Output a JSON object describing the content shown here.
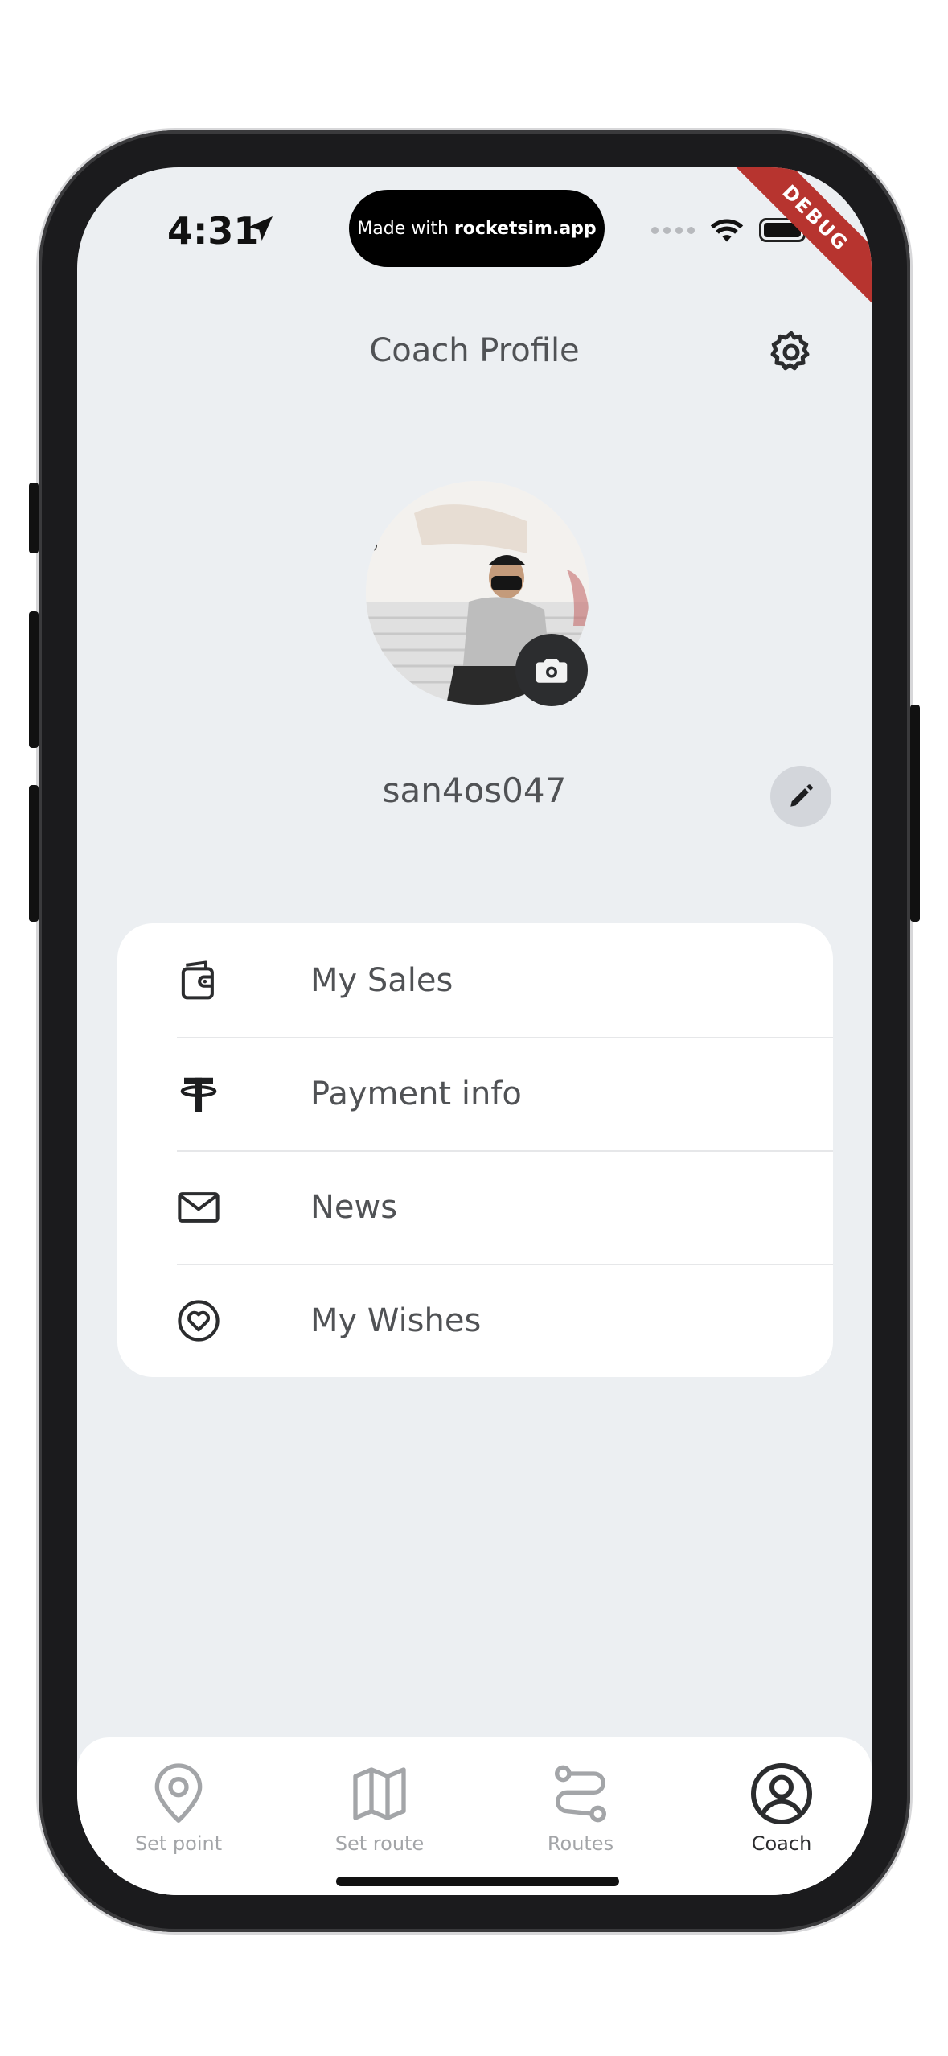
{
  "status_bar": {
    "time": "4:31",
    "island_text_prefix": "Made with ",
    "island_text_bold": "rocketsim.app",
    "debug_label": "DEBUG"
  },
  "header": {
    "title": "Coach Profile"
  },
  "profile": {
    "username": "san4os047"
  },
  "menu": {
    "items": [
      {
        "label": "My Sales",
        "icon": "wallet-icon"
      },
      {
        "label": "Payment info",
        "icon": "tether-icon"
      },
      {
        "label": "News",
        "icon": "mail-icon"
      },
      {
        "label": "My Wishes",
        "icon": "heart-circle-icon"
      }
    ]
  },
  "bottom_nav": {
    "tabs": [
      {
        "label": "Set point",
        "icon": "map-pin-icon",
        "active": false
      },
      {
        "label": "Set route",
        "icon": "map-icon",
        "active": false
      },
      {
        "label": "Routes",
        "icon": "route-icon",
        "active": false
      },
      {
        "label": "Coach",
        "icon": "user-circle-icon",
        "active": true
      }
    ]
  },
  "colors": {
    "screen_bg": "#eceff2",
    "text": "#505255",
    "inactive_tab": "#a3a5a8",
    "debug_ribbon": "#b7342f"
  }
}
